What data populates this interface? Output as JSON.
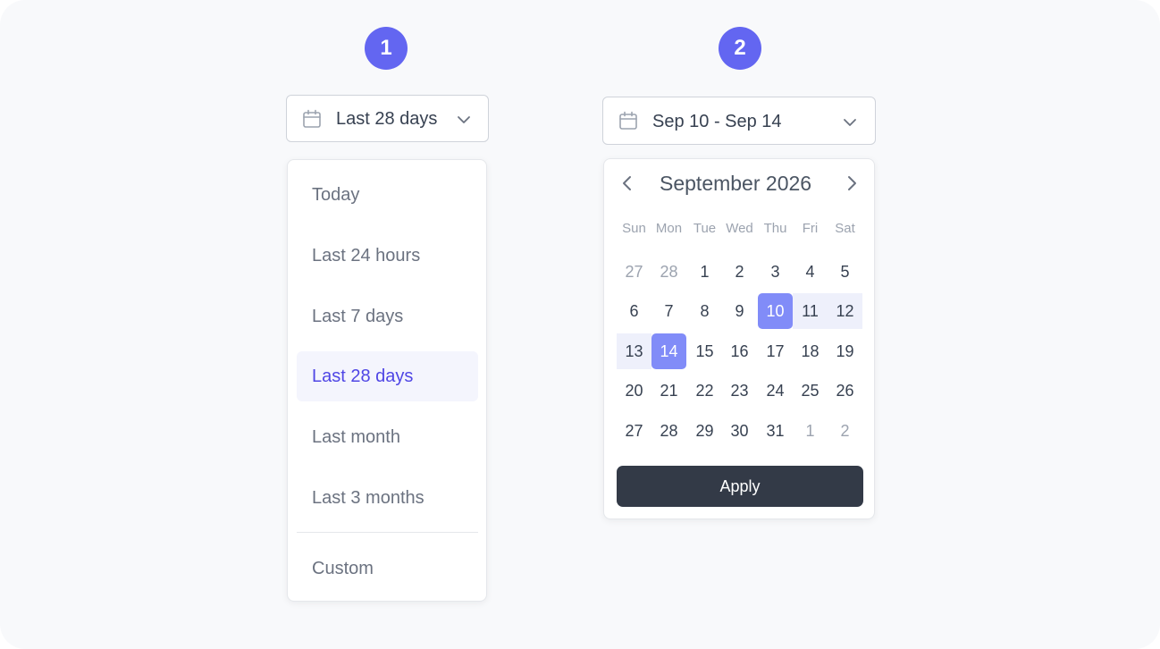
{
  "steps": [
    "1",
    "2"
  ],
  "presets": {
    "selected_label": "Last 28 days",
    "items": [
      "Today",
      "Last 24 hours",
      "Last 7 days",
      "Last 28 days",
      "Last month",
      "Last 3 months"
    ],
    "active_index": 3,
    "custom_label": "Custom"
  },
  "range_picker": {
    "selected_label": "Sep 10 - Sep 14",
    "month_title": "September 2026",
    "weekdays": [
      "Sun",
      "Mon",
      "Tue",
      "Wed",
      "Thu",
      "Fri",
      "Sat"
    ],
    "weeks": [
      [
        "27",
        "28",
        "1",
        "2",
        "3",
        "4",
        "5"
      ],
      [
        "6",
        "7",
        "8",
        "9",
        "10",
        "11",
        "12"
      ],
      [
        "13",
        "14",
        "15",
        "16",
        "17",
        "18",
        "19"
      ],
      [
        "20",
        "21",
        "22",
        "23",
        "24",
        "25",
        "26"
      ],
      [
        "27",
        "28",
        "29",
        "30",
        "31",
        "1",
        "2"
      ]
    ],
    "range_start": "10",
    "range_end": "14",
    "apply_label": "Apply"
  },
  "icons": {
    "trigger_left": "calendar-icon",
    "trigger_right": "chevron-down-icon",
    "prev": "chevron-left-icon",
    "next": "chevron-right-icon"
  },
  "colors": {
    "accent": "#6366f1",
    "active_text": "#4f46e5",
    "selected_day": "#818cf8",
    "range_fill": "#eef0fb",
    "apply_button": "#333a47"
  }
}
